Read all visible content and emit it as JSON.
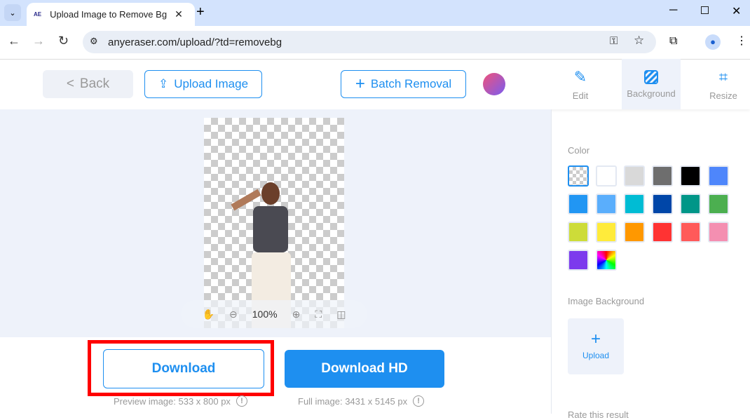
{
  "browser": {
    "tab_title": "Upload Image to Remove Bg",
    "favicon": "AE",
    "url": "anyeraser.com/upload/?td=removebg"
  },
  "header": {
    "back": "Back",
    "upload": "Upload Image",
    "batch": "Batch Removal"
  },
  "tools": [
    {
      "label": "Edit",
      "icon": "edit-icon"
    },
    {
      "label": "Background",
      "icon": "background-icon",
      "active": true
    },
    {
      "label": "Resize",
      "icon": "crop-icon"
    }
  ],
  "viewer": {
    "zoom": "100%"
  },
  "download": {
    "label": "Download",
    "note": "Preview image: 533 x 800 px"
  },
  "download_hd": {
    "label": "Download HD",
    "note": "Full image: 3431 x 5145 px"
  },
  "panel": {
    "color_title": "Color",
    "swatches": [
      "transparent",
      "#ffffff",
      "#d9d9d9",
      "#6e6e6e",
      "#000000",
      "#4e86fb",
      "#2196f3",
      "#5aaefc",
      "#00bcd4",
      "#0046a8",
      "#009688",
      "#4caf50",
      "#cddc39",
      "#ffeb3b",
      "#ff9800",
      "#ff3333",
      "#ff5a5a",
      "#f48fb1",
      "#7c3aed",
      "rainbow"
    ],
    "selected": "transparent",
    "image_bg_title": "Image Background",
    "upload": "Upload",
    "rate": "Rate this result"
  },
  "colors": {
    "accent": "#1e8ff0",
    "highlight": "#ff0000"
  }
}
